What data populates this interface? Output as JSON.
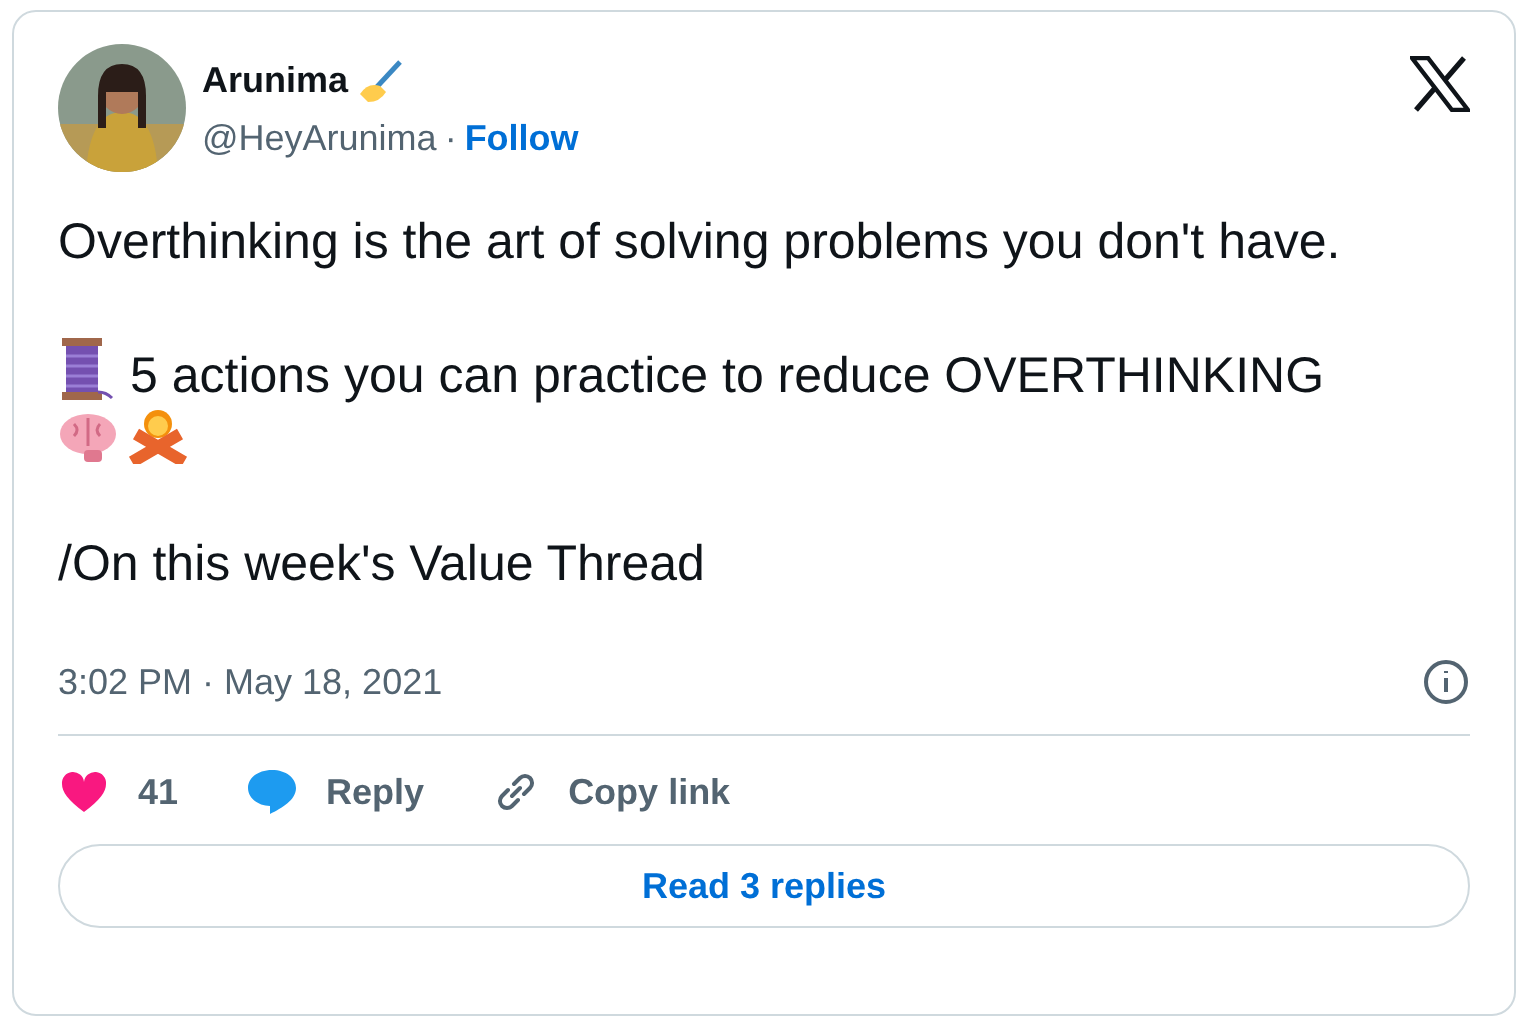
{
  "author": {
    "name": "Arunima",
    "handle": "@HeyArunima",
    "separator": "·",
    "follow": "Follow"
  },
  "body": [
    {
      "kind": "text",
      "text": "Overthinking is the art of solving problems you don't have."
    },
    {
      "kind": "thread",
      "text": "5 actions you can practice to reduce OVERTHINKING"
    },
    {
      "kind": "text",
      "text": "/On this week's Value Thread"
    }
  ],
  "timestamp": "3:02 PM · May 18, 2021",
  "actions": [
    {
      "kind": "like",
      "label": "41"
    },
    {
      "kind": "reply",
      "label": "Reply"
    },
    {
      "kind": "copy",
      "label": "Copy link"
    }
  ],
  "read_replies": "Read 3 replies"
}
